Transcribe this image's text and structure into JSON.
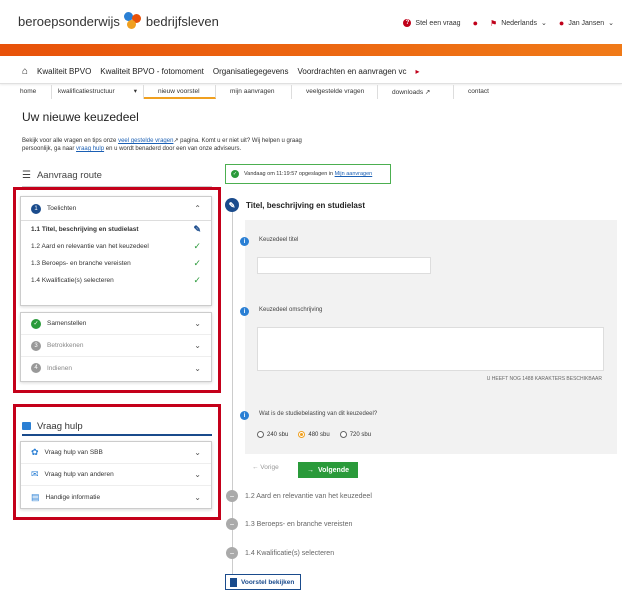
{
  "header": {
    "logo_text_1": "beroepsonderwijs",
    "logo_text_2": "bedrijfsleven",
    "ask_question": "Stel een vraag",
    "language": "Nederlands",
    "user": "Jan Jansen"
  },
  "nav_main": {
    "items": [
      "Kwaliteit BPVO",
      "Kwaliteit BPVO - fotomoment",
      "Organisatiegegevens",
      "Voordrachten en aanvragen vc"
    ]
  },
  "nav_sub": {
    "tabs": [
      "home",
      "kwalificatiestructuur",
      "nieuw voorstel",
      "mijn aanvragen",
      "veelgestelde vragen",
      "downloads",
      "contact"
    ]
  },
  "page": {
    "title": "Uw nieuwe keuzedeel",
    "intro_1": "Bekijk voor alle vragen en tips onze ",
    "intro_link_1": "veel gestelde vragen",
    "intro_2": " pagina. Komt u er niet uit? Wij helpen u graag persoonlijk, ga naar ",
    "intro_link_2": "vraag hulp",
    "intro_3": " en u wordt benaderd door een van onze adviseurs."
  },
  "route": {
    "heading": "Aanvraag route",
    "step1": {
      "number": "1",
      "label": "Toelichten"
    },
    "substeps": [
      {
        "label": "1.1 Titel, beschrijving en studielast",
        "status": "edit"
      },
      {
        "label": "1.2 Aard en relevantie van het keuzedeel",
        "status": "done"
      },
      {
        "label": "1.3 Beroeps- en branche vereisten",
        "status": "done"
      },
      {
        "label": "1.4 Kwalificatie(s) selecteren",
        "status": "done"
      }
    ],
    "other_steps": [
      {
        "number": "✓",
        "label": "Samenstellen",
        "color": "#2a9a3a"
      },
      {
        "number": "3",
        "label": "Betrokkenen",
        "color": "#999999"
      },
      {
        "number": "4",
        "label": "Indienen",
        "color": "#999999"
      }
    ]
  },
  "help": {
    "heading": "Vraag hulp",
    "items": [
      "Vraag hulp van SBB",
      "Vraag hulp van anderen",
      "Handige informatie"
    ]
  },
  "main": {
    "saved_prefix": "Vandaag om 11:19:57 opgeslagen in ",
    "saved_link": "Mijn aanvragen",
    "section_title": "Titel, beschrijving en studielast",
    "field_title_label": "Keuzedeel titel",
    "field_desc_label": "Keuzedeel omschrijving",
    "chars_left": "U HEEFT NOG 1488 KARAKTERS BESCHIKBAAR",
    "study_question": "Wat is de studiebelasting van dit keuzedeel?",
    "study_options": [
      "240 sbu",
      "480 sbu",
      "720 sbu"
    ],
    "study_selected": "480 sbu",
    "prev_label": "← Vorige",
    "next_label": "Volgende",
    "next_steps": [
      "1.2 Aard en relevantie van het keuzedeel",
      "1.3 Beroeps- en branche vereisten",
      "1.4 Kwalificatie(s) selecteren"
    ],
    "view_button": "Voorstel bekijken"
  },
  "colors": {
    "accent_orange": "#e8520a",
    "brand_blue": "#1a4b8c",
    "success_green": "#2a9a3a",
    "highlight_red": "#c4001a"
  }
}
